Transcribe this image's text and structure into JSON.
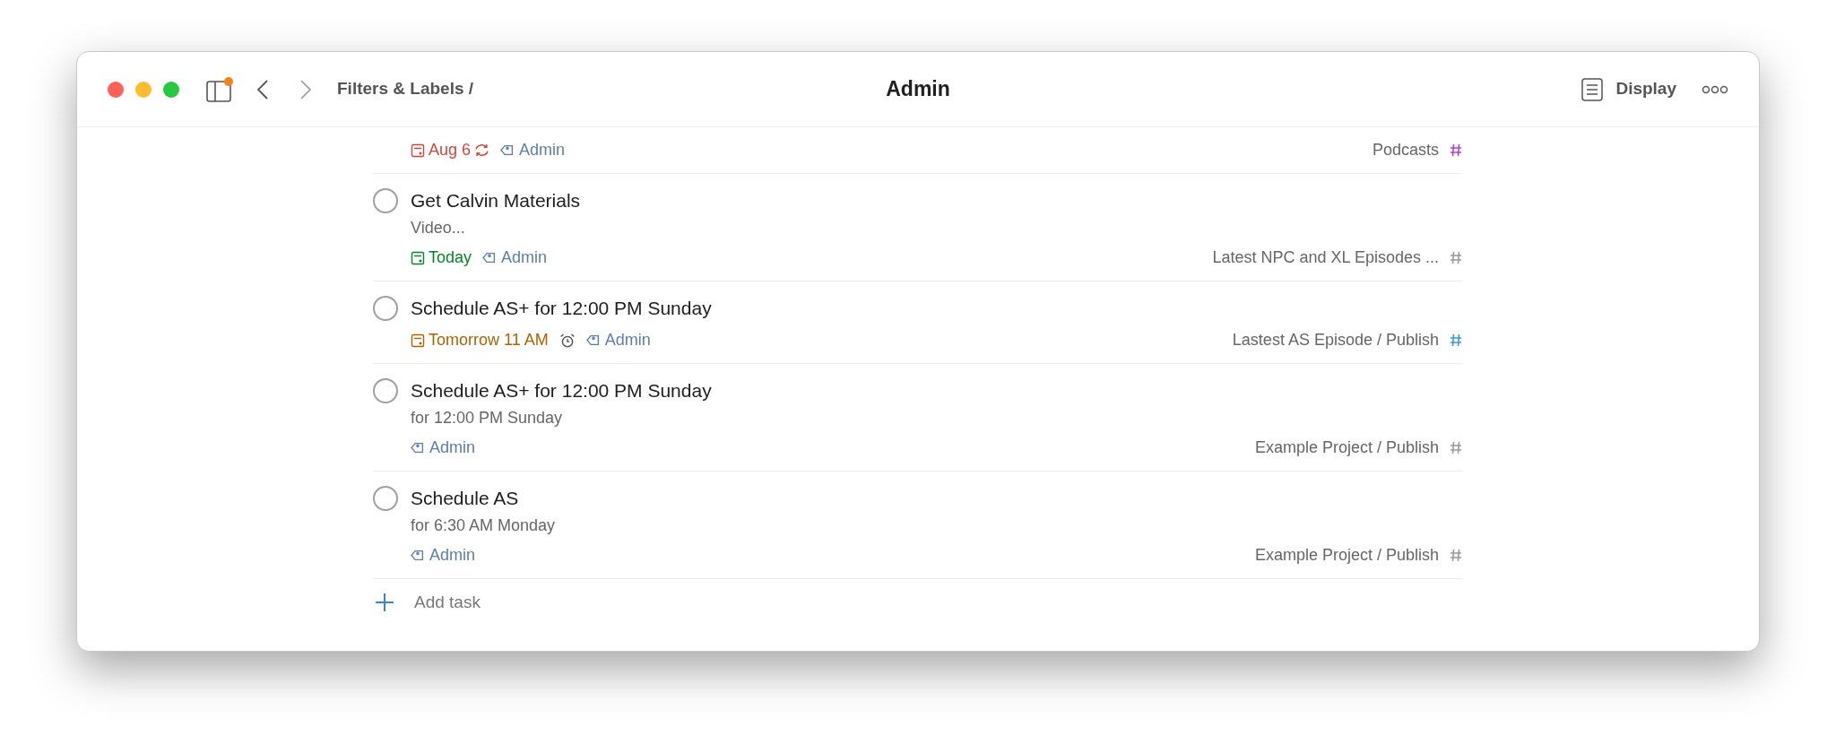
{
  "header": {
    "breadcrumb": "Filters & Labels /",
    "title": "Admin",
    "display_label": "Display",
    "sidebar_badge": true
  },
  "tasks": [
    {
      "due": {
        "text": "Aug 6",
        "kind": "overdue"
      },
      "recurring": true,
      "labels": [
        "Admin"
      ],
      "project": {
        "name": "Podcasts",
        "color": "#b33fd6"
      }
    },
    {
      "title": "Get Calvin Materials",
      "checked": false,
      "description": "Video...",
      "due": {
        "text": "Today",
        "kind": "today"
      },
      "labels": [
        "Admin"
      ],
      "project": {
        "name": "Latest NPC and XL Episodes ...",
        "color": "#999999"
      }
    },
    {
      "title": "Schedule AS+ for 12:00 PM Sunday",
      "checked": false,
      "due": {
        "text": "Tomorrow 11 AM",
        "kind": "upcoming"
      },
      "reminder": true,
      "labels": [
        "Admin"
      ],
      "project": {
        "name": "Lastest AS Episode / Publish",
        "color": "#3a9bd4"
      }
    },
    {
      "title": "Schedule AS+ for 12:00 PM Sunday",
      "checked": false,
      "description": "for 12:00 PM Sunday",
      "labels": [
        "Admin"
      ],
      "project": {
        "name": "Example Project / Publish",
        "color": "#999999"
      }
    },
    {
      "title": "Schedule AS",
      "checked": false,
      "description": "for 6:30 AM Monday",
      "labels": [
        "Admin"
      ],
      "project": {
        "name": "Example Project / Publish",
        "color": "#999999"
      }
    }
  ],
  "add_task": "Add task"
}
